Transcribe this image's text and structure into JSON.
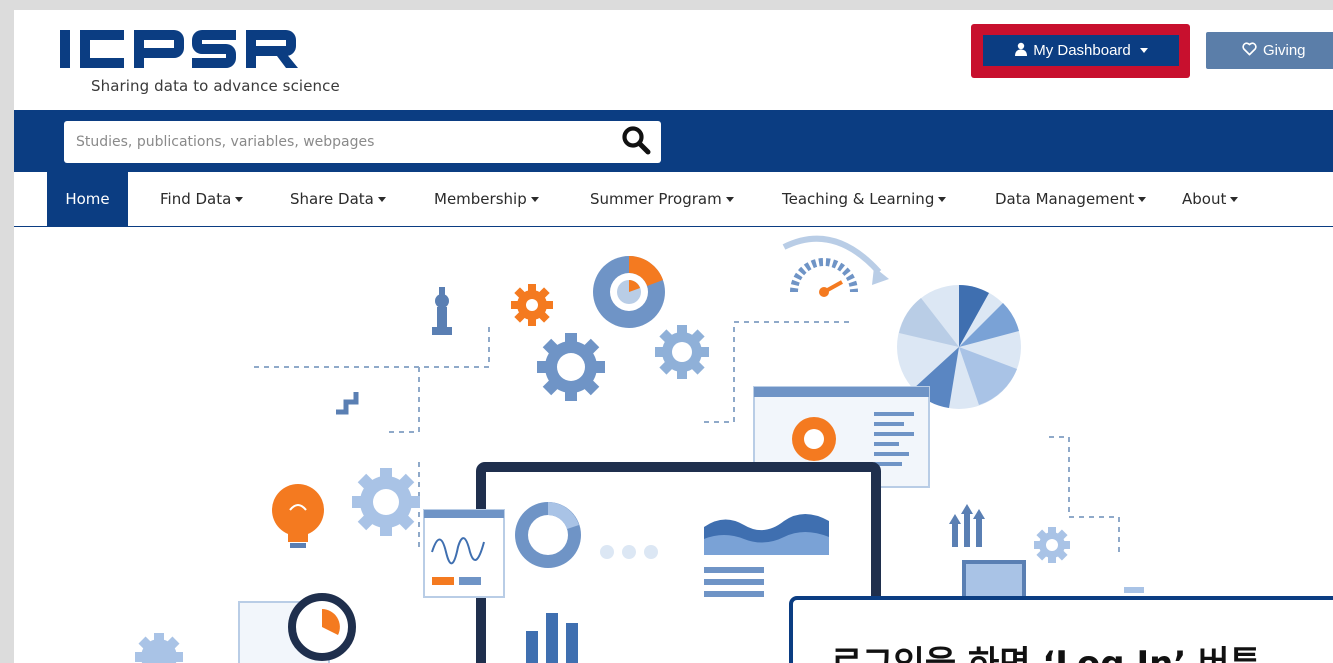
{
  "header": {
    "logo_text": "ICPSR",
    "tagline": "Sharing data to advance science",
    "dashboard_label": "My Dashboard",
    "giving_label": "Giving"
  },
  "search": {
    "placeholder": "Studies, publications, variables, webpages"
  },
  "nav": {
    "items": [
      {
        "label": "Home",
        "active": true
      },
      {
        "label": "Find Data",
        "dropdown": true
      },
      {
        "label": "Share Data",
        "dropdown": true
      },
      {
        "label": "Membership",
        "dropdown": true
      },
      {
        "label": "Summer Program",
        "dropdown": true
      },
      {
        "label": "Teaching & Learning",
        "dropdown": true
      },
      {
        "label": "Data Management",
        "dropdown": true
      },
      {
        "label": "About",
        "dropdown": true
      }
    ]
  },
  "callout": {
    "text": "로그인을 하면 ‘Log In’ 버튼"
  },
  "colors": {
    "brand_blue": "#0b3d82",
    "highlight_red": "#c8102e",
    "giving_blue": "#5b7ea9",
    "accent_orange": "#f47a20",
    "illustration_blue": "#6f94c6"
  }
}
